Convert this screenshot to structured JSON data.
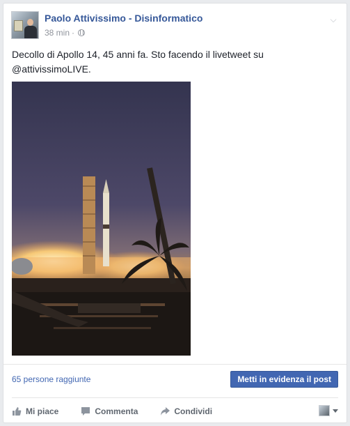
{
  "post": {
    "author": "Paolo Attivissimo - Disinformatico",
    "time": "38 min",
    "separator": "·",
    "icons": {
      "audience": "globe-icon",
      "menu": "chevron-down-icon"
    },
    "text_line1": "Decollo di Apollo 14, 45 anni fa. Sto facendo il livetweet su",
    "text_line2": "@attivissimoLIVE."
  },
  "insights": {
    "reach": "65 persone raggiunte",
    "boost_label": "Metti in evidenza il post"
  },
  "actions": {
    "like": "Mi piace",
    "comment": "Commenta",
    "share": "Condividi",
    "icons": {
      "like": "thumbs-up-icon",
      "comment": "comment-icon",
      "share": "share-arrow-icon"
    }
  },
  "colors": {
    "link": "#365899",
    "button": "#4267b2",
    "muted": "#90949c"
  }
}
